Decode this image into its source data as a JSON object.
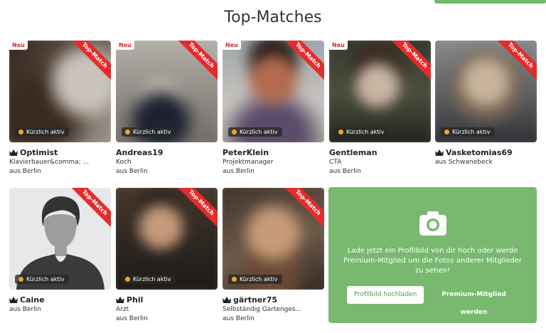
{
  "page_title": "Top-Matches",
  "labels": {
    "new": "Neu",
    "top_match": "Top-Match",
    "recently_active": "Kürzlich aktiv"
  },
  "colors": {
    "ribbon": "#e32c2c",
    "active_dot": "#f5a623",
    "promo_green": "#78b96f"
  },
  "profiles": [
    {
      "name": "Optimist",
      "premium": true,
      "is_new": true,
      "occupation": "Klavierbauer&comma; ...",
      "location": "aus Berlin"
    },
    {
      "name": "Andreas19",
      "premium": false,
      "is_new": true,
      "occupation": "Koch",
      "location": "aus Berlin"
    },
    {
      "name": "PeterKlein",
      "premium": false,
      "is_new": true,
      "occupation": "Projektmanager",
      "location": "aus Berlin"
    },
    {
      "name": "Gentleman",
      "premium": false,
      "is_new": true,
      "occupation": "CTA",
      "location": "aus Berlin"
    },
    {
      "name": "Vasketomias69",
      "premium": true,
      "is_new": false,
      "occupation": "aus Schwanebeck",
      "location": ""
    },
    {
      "name": "Caine",
      "premium": true,
      "is_new": false,
      "occupation": "aus Berlin",
      "location": ""
    },
    {
      "name": "Phil",
      "premium": true,
      "is_new": false,
      "occupation": "Arzt",
      "location": "aus Berlin"
    },
    {
      "name": "gärtner75",
      "premium": true,
      "is_new": false,
      "occupation": "Selbständig Gartenges...",
      "location": "aus Berlin"
    }
  ],
  "promo": {
    "text": "Lade jetzt ein Profilbild von dir hoch oder werde Premium-Mitglied um die Fotos anderer Mitglieder zu sehen!",
    "upload_button": "Profilbild hochladen",
    "premium_button": "Premium-Mitglied werden"
  }
}
